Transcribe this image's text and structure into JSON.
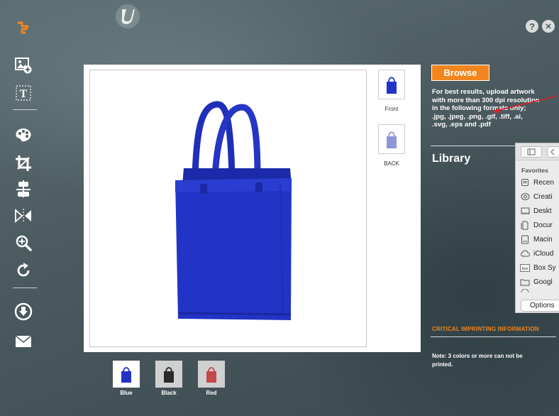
{
  "colors": {
    "accent": "#f0861d",
    "bag_blue": "#2234c6",
    "bag_black": "#2a2a2a",
    "bag_red": "#c44848"
  },
  "top": {
    "help_label": "?",
    "close_label": "✕"
  },
  "toolbar": {
    "items": [
      "cart-icon",
      "add-image-icon",
      "text-icon",
      "palette-icon",
      "crop-icon",
      "align-icon",
      "flip-icon",
      "zoom-icon",
      "rotate-icon",
      "download-icon",
      "mail-icon"
    ],
    "text_glyph": "T"
  },
  "views": [
    {
      "label": "Front"
    },
    {
      "label": "BACK"
    }
  ],
  "swatches": [
    {
      "label": "Blue",
      "color": "#2234c6"
    },
    {
      "label": "Black",
      "color": "#2a2a2a"
    },
    {
      "label": "Red",
      "color": "#c44848"
    }
  ],
  "panel": {
    "browse_label": "Browse",
    "info_lines": [
      "For best results, upload artwork",
      "with more than 300 dpi resolution",
      "in the following formats only;",
      ".jpg, .jpeg, .png, .gif, .tiff, .ai,",
      ".svg, .eps and .pdf"
    ],
    "library_title": "Library",
    "critical_title": "CRITICAL IMPRINTING INFORMATION",
    "note_lines": [
      "Note: 3 colors or more can not be",
      "printed."
    ]
  },
  "finder": {
    "favorites_label": "Favorites",
    "items": [
      {
        "label": "Recen",
        "icon": "recents-icon"
      },
      {
        "label": "Creati",
        "icon": "creative-cloud-icon"
      },
      {
        "label": "Deskt",
        "icon": "desktop-icon"
      },
      {
        "label": "Docur",
        "icon": "documents-icon"
      },
      {
        "label": "Macin",
        "icon": "hard-drive-icon"
      },
      {
        "label": "iCloud",
        "icon": "icloud-icon"
      },
      {
        "label": "Box Sy",
        "icon": "box-icon"
      },
      {
        "label": "Googl",
        "icon": "folder-icon"
      }
    ],
    "options_label": "Options",
    "box_icon_text": "box"
  }
}
